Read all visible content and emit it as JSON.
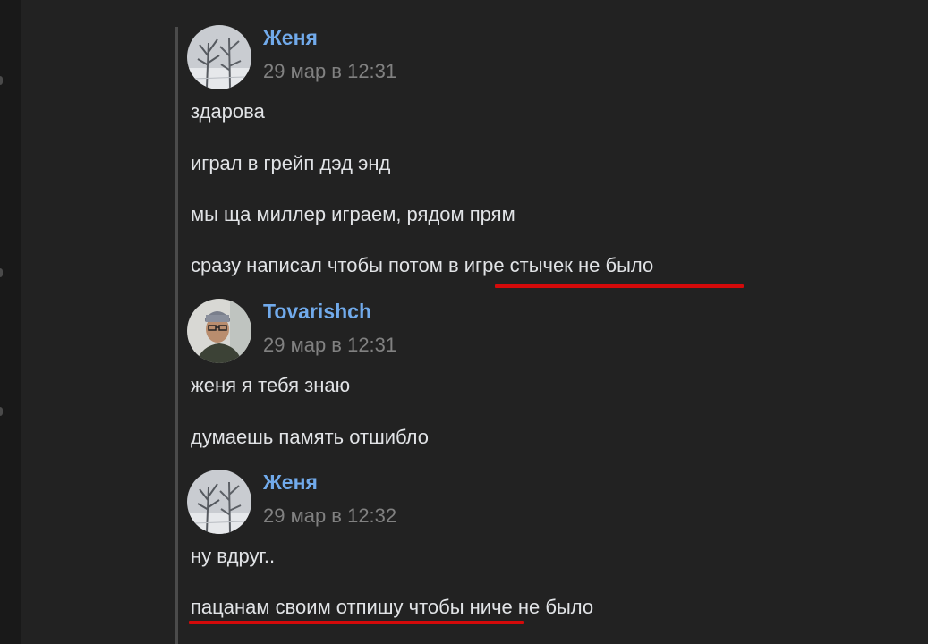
{
  "conversation": {
    "groups": [
      {
        "author": "Женя",
        "time": "29 мар в 12:31",
        "avatar": "snowy-trees-photo",
        "messages": [
          "здарова",
          "играл в грейп дэд энд",
          "мы ща миллер играем, рядом прям",
          "сразу написал чтобы потом в игре стычек не было"
        ]
      },
      {
        "author": "Tovarishch",
        "time": "29 мар в 12:31",
        "avatar": "person-with-glasses-photo",
        "messages": [
          "женя я тебя знаю",
          "думаешь память отшибло"
        ]
      },
      {
        "author": "Женя",
        "time": "29 мар в 12:32",
        "avatar": "snowy-trees-photo",
        "messages": [
          "ну вдруг..",
          "пацанам своим отпишу чтобы ниче не было"
        ]
      }
    ]
  },
  "annotations": {
    "underline_color": "#d40a0a"
  },
  "colors": {
    "background": "#222222",
    "author_name": "#71aaeb",
    "message_text": "#e1e3e6",
    "timestamp": "#818181"
  }
}
